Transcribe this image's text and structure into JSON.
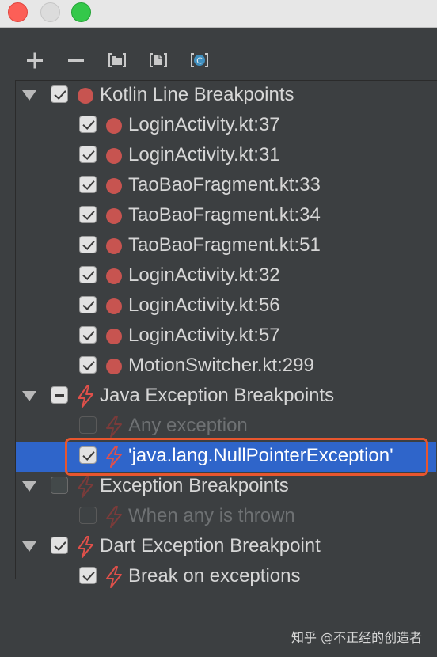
{
  "toolbar": {
    "add_label": "+",
    "remove_label": "−",
    "group_icon": "folder-icon",
    "group_file_icon": "file-group-icon",
    "class_icon": "class-icon",
    "class_letter": "C"
  },
  "tree": {
    "groups": [
      {
        "label": "Kotlin Line Breakpoints",
        "checked": "checked",
        "icon": "red-dot",
        "expanded": true,
        "items": [
          {
            "label": "LoginActivity.kt:37",
            "checked": "checked",
            "icon": "red-dot"
          },
          {
            "label": "LoginActivity.kt:31",
            "checked": "checked",
            "icon": "red-dot"
          },
          {
            "label": "TaoBaoFragment.kt:33",
            "checked": "checked",
            "icon": "red-dot"
          },
          {
            "label": "TaoBaoFragment.kt:34",
            "checked": "checked",
            "icon": "red-dot"
          },
          {
            "label": "TaoBaoFragment.kt:51",
            "checked": "checked",
            "icon": "red-dot"
          },
          {
            "label": "LoginActivity.kt:32",
            "checked": "checked",
            "icon": "red-dot"
          },
          {
            "label": "LoginActivity.kt:56",
            "checked": "checked",
            "icon": "red-dot"
          },
          {
            "label": "LoginActivity.kt:57",
            "checked": "checked",
            "icon": "red-dot"
          },
          {
            "label": "MotionSwitcher.kt:299",
            "checked": "checked",
            "icon": "red-dot"
          }
        ]
      },
      {
        "label": "Java Exception Breakpoints",
        "checked": "partial",
        "icon": "lightning",
        "expanded": true,
        "items": [
          {
            "label": "Any exception",
            "checked": "unchecked",
            "icon": "lightning"
          },
          {
            "label": "'java.lang.NullPointerException'",
            "checked": "checked",
            "icon": "lightning",
            "selected": true
          }
        ]
      },
      {
        "label": "Exception Breakpoints",
        "checked": "unchecked",
        "icon": "lightning",
        "expanded": true,
        "items": [
          {
            "label": "When any is thrown",
            "checked": "unchecked",
            "icon": "lightning"
          }
        ]
      },
      {
        "label": "Dart Exception Breakpoint",
        "checked": "checked",
        "icon": "lightning",
        "expanded": true,
        "items": [
          {
            "label": "Break on exceptions",
            "checked": "checked",
            "icon": "lightning"
          }
        ]
      }
    ]
  },
  "colors": {
    "background": "#3c3f41",
    "selection": "#2f65ca",
    "breakpoint_red": "#c75450",
    "highlight_orange": "#e8562e"
  },
  "watermark": "知乎 @不正经的创造者"
}
